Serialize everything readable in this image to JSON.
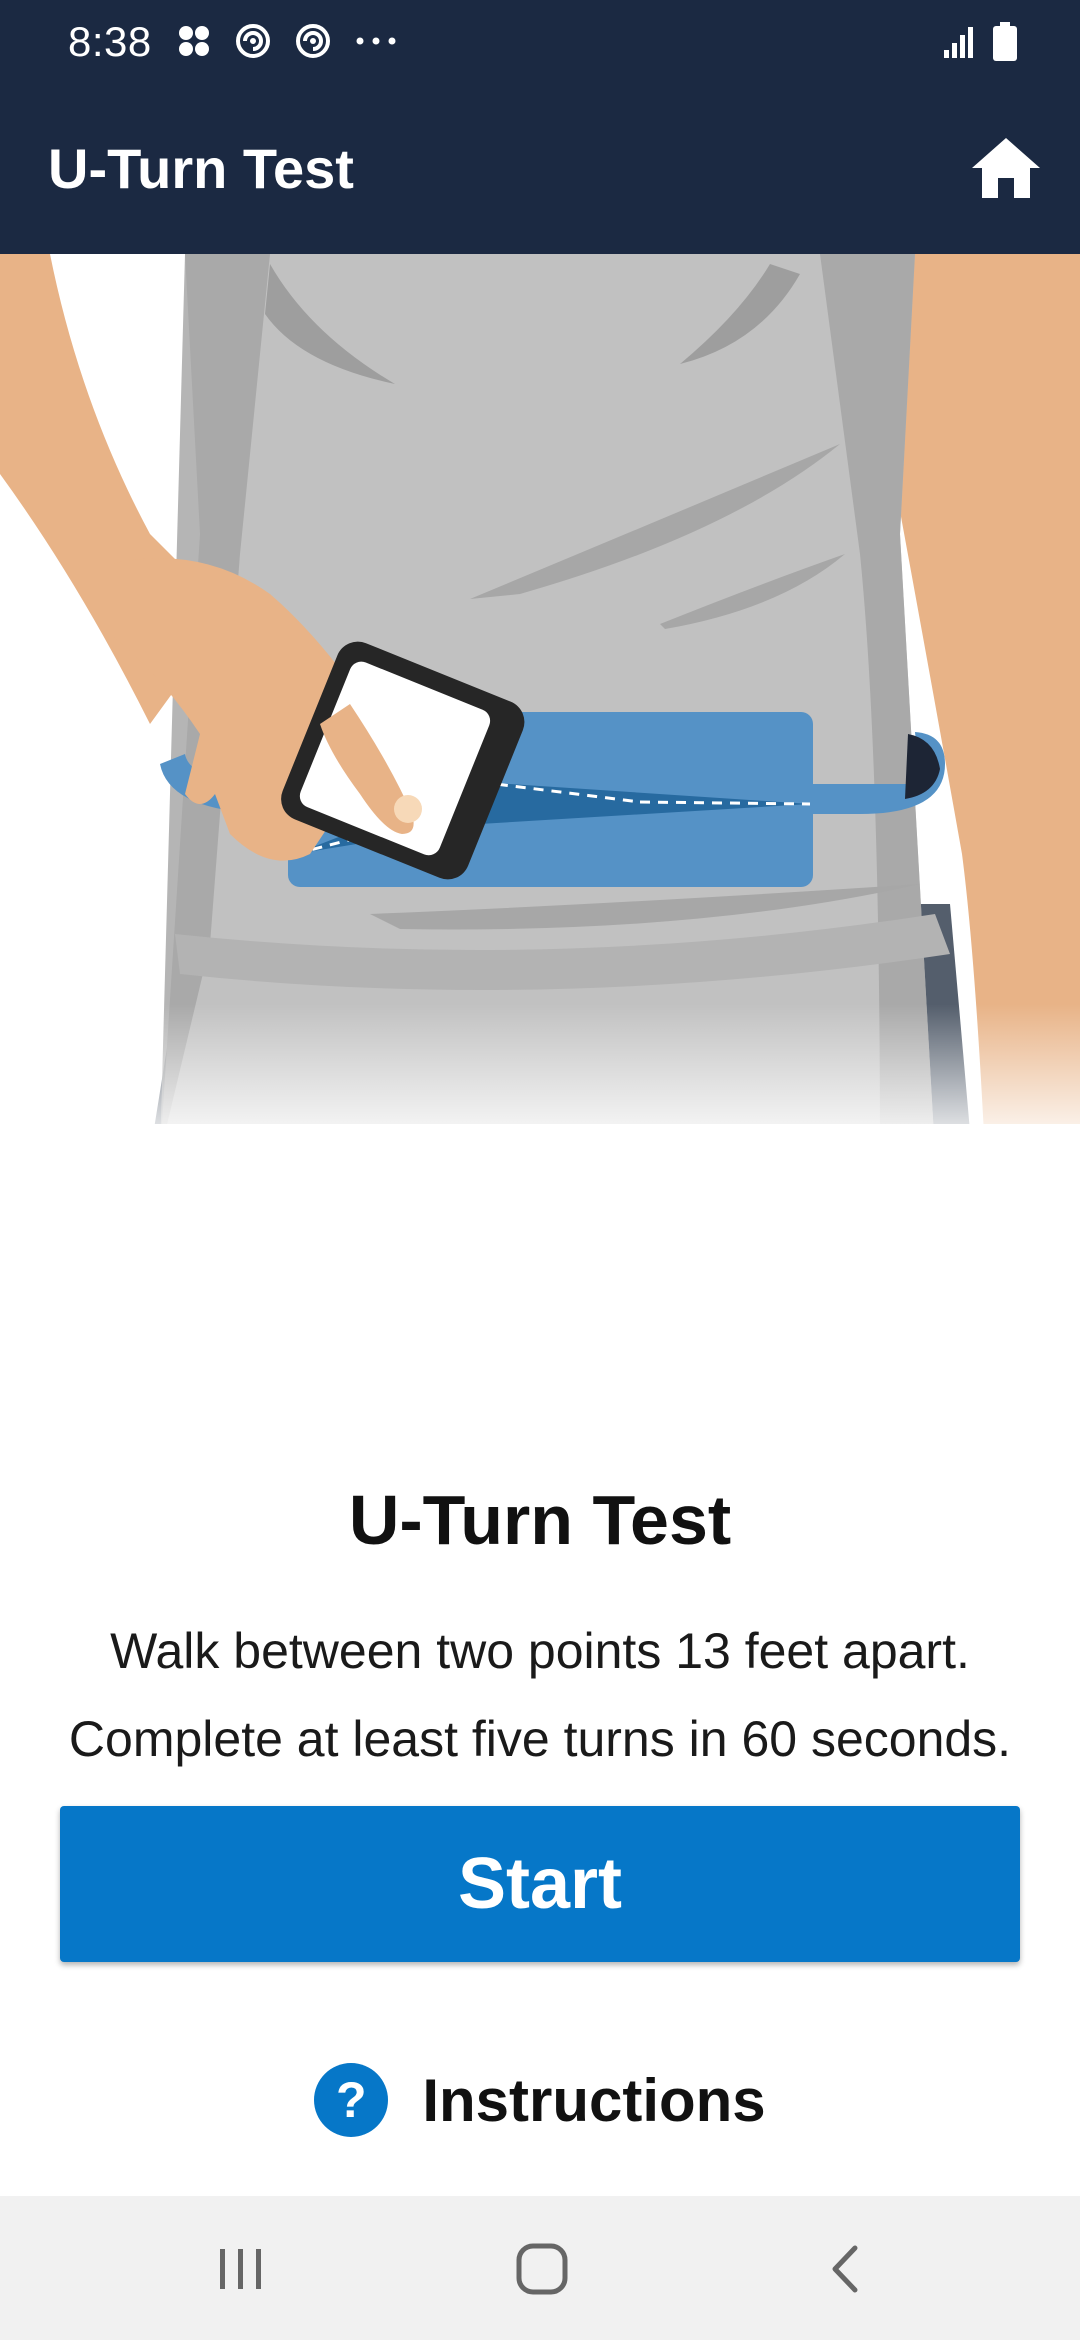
{
  "status_bar": {
    "time": "8:38",
    "left_icons": [
      "apps-icon",
      "sync-icon",
      "sync-icon",
      "more-dots-icon"
    ],
    "right_icons": [
      "signal-icon",
      "battery-icon"
    ]
  },
  "app_bar": {
    "title": "U-Turn Test",
    "home_icon": "home-icon"
  },
  "illustration": {
    "subject": "person wearing belt pouch holding phone"
  },
  "content": {
    "title": "U-Turn Test",
    "description_line1": "Walk between two points 13 feet apart.",
    "description_line2": "Complete at least five turns in 60 seconds.",
    "start_label": "Start",
    "instructions_label": "Instructions",
    "instructions_icon": "?"
  },
  "nav_bar": {
    "items": [
      "recents-icon",
      "home-nav-icon",
      "back-icon"
    ]
  },
  "colors": {
    "header_bg": "#1b2942",
    "accent": "#0677c8",
    "shirt": "#c1c1c1",
    "skin": "#e8b387",
    "belt": "#5592c6",
    "pants": "#545e6c"
  }
}
